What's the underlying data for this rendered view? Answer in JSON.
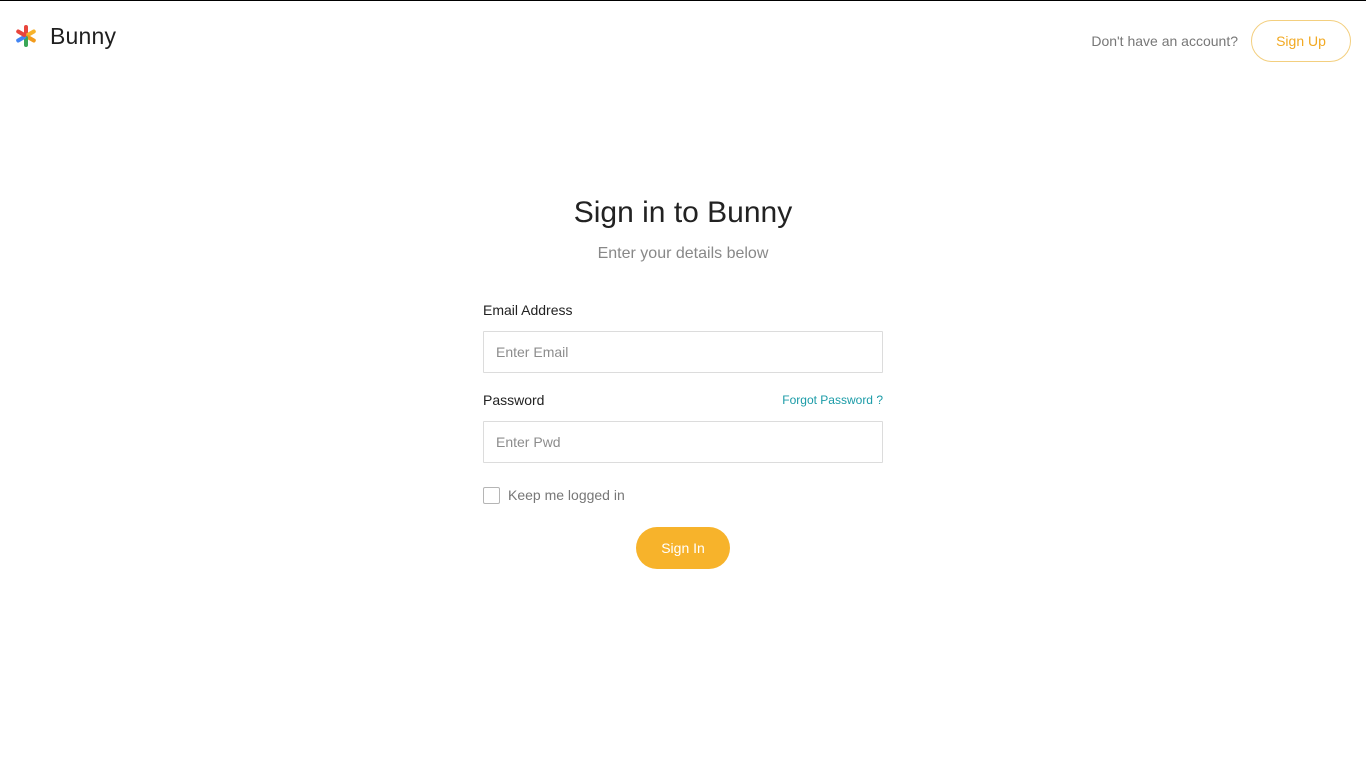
{
  "header": {
    "brand_name": "Bunny",
    "logo_icon": "asterisk-flower-icon",
    "prompt_text": "Don't have an account?",
    "signup_label": "Sign Up"
  },
  "form": {
    "title": "Sign in to Bunny",
    "subtitle": "Enter your details below",
    "email": {
      "label": "Email Address",
      "placeholder": "Enter Email",
      "value": ""
    },
    "password": {
      "label": "Password",
      "placeholder": "Enter Pwd",
      "value": "",
      "forgot_label": "Forgot Password ?"
    },
    "remember": {
      "label": "Keep me logged in",
      "checked": false
    },
    "submit_label": "Sign In"
  },
  "colors": {
    "accent": "#f7b32b",
    "accent_text": "#f2a922",
    "link": "#1a9ba7",
    "logo_petals": [
      "#e8453c",
      "#f7b32b",
      "#3aa757",
      "#4285f4"
    ]
  }
}
